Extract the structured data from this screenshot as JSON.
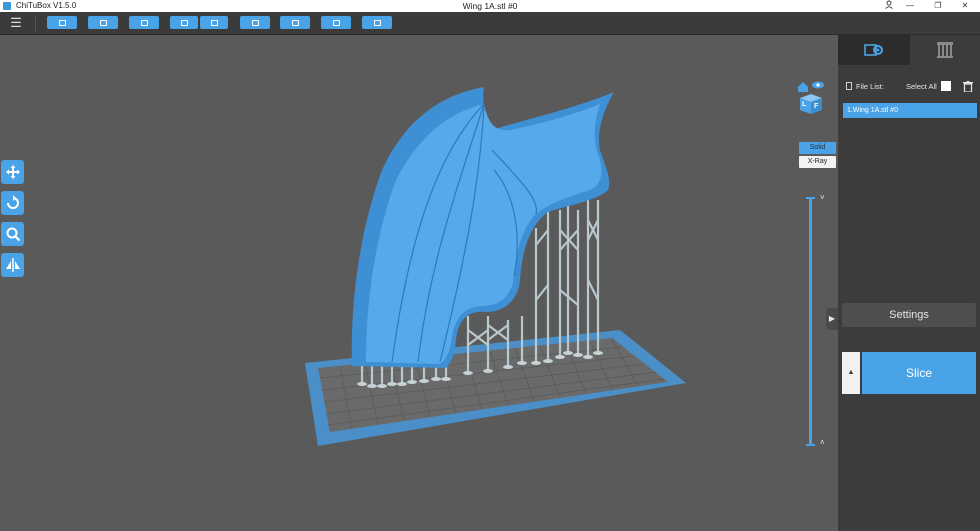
{
  "app": {
    "name": "ChiTuBox V1.5.0",
    "window_title": "Wing 1A.stl #0"
  },
  "window_controls": {
    "account_icon": "user-icon",
    "minimize": "—",
    "restore": "❐",
    "close": "✕"
  },
  "toolbar": {
    "menu_glyph": "☰",
    "buttons": [
      {
        "name": "open-file-icon"
      },
      {
        "name": "save-icon"
      },
      {
        "name": "select-icon"
      },
      {
        "name": "import-icon"
      },
      {
        "name": "export-icon"
      },
      {
        "name": "document-icon"
      },
      {
        "name": "network-icon"
      },
      {
        "name": "printer-icon"
      },
      {
        "name": "stop-icon"
      }
    ],
    "accent_color": "#4aa3e6"
  },
  "viewport": {
    "left_tools": [
      "move-icon",
      "rotate-icon",
      "scale-icon",
      "mirror-icon"
    ],
    "view_modes": {
      "solid": "Solid",
      "xray": "X-Ray"
    },
    "viewcube_faces": {
      "front": "F",
      "left": "L"
    },
    "layer_chevron_up": "˄",
    "layer_chevron_down": "˅",
    "collapse_glyph": "▶"
  },
  "panel": {
    "tabs": [
      "settings-gear-tab",
      "supports-tab"
    ],
    "file_list_label": "File List:",
    "select_all_label": "Select All",
    "files": [
      "1.Wing 1A.stl #0"
    ],
    "settings_label": "Settings",
    "slice_label": "Slice",
    "slice_expand_glyph": "▲"
  }
}
